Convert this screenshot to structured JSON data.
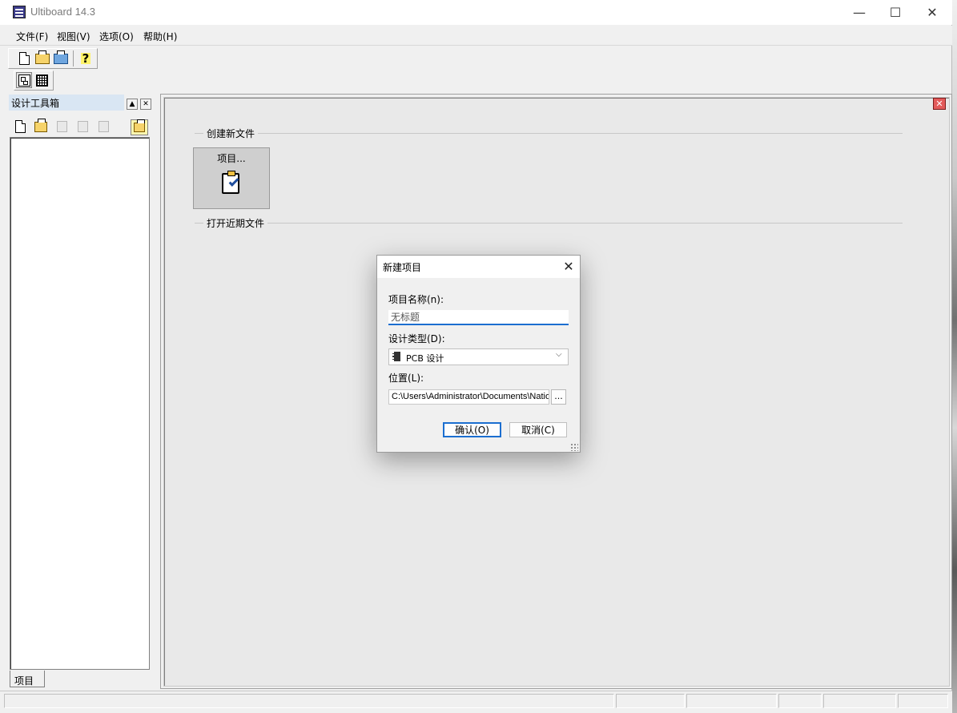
{
  "window": {
    "title": "Ultiboard 14.3",
    "caption_buttons": {
      "minimize": "—",
      "maximize": "☐",
      "close": "✕"
    }
  },
  "menubar": {
    "items": [
      {
        "label": "文件(F)"
      },
      {
        "label": "视图(V)"
      },
      {
        "label": "选项(O)"
      },
      {
        "label": "帮助(H)"
      }
    ]
  },
  "toolbar_main": {
    "buttons": [
      {
        "icon": "new-file-icon"
      },
      {
        "icon": "open-folder-icon"
      },
      {
        "icon": "open-project-icon"
      },
      {
        "icon": "help-icon"
      }
    ]
  },
  "toolbar_view": {
    "buttons": [
      {
        "icon": "design-view-icon"
      },
      {
        "icon": "spreadsheet-view-icon"
      }
    ]
  },
  "left_panel": {
    "title": "设计工具箱",
    "tab_label": "项目"
  },
  "main": {
    "section_create": "创建新文件",
    "section_recent": "打开近期文件",
    "project_tile_label": "项目..."
  },
  "dialog": {
    "title": "新建项目",
    "name_label": "项目名称(n):",
    "name_value": "无标题",
    "type_label": "设计类型(D):",
    "type_value": "PCB 设计",
    "location_label": "位置(L):",
    "location_value": "C:\\Users\\Administrator\\Documents\\Natio",
    "browse_label": "...",
    "ok_label": "确认(O)",
    "cancel_label": "取消(C)"
  },
  "colors": {
    "accent_focus": "#1b6ed0",
    "panel_caption": "#d9e6f3"
  }
}
